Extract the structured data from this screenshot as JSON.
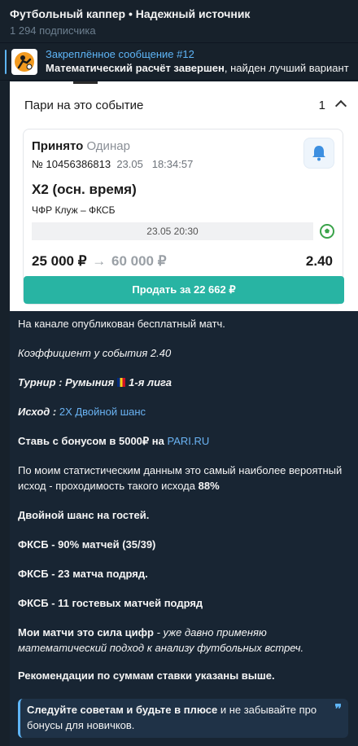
{
  "channel": {
    "title": "Футбольный каппер • Надежный источник",
    "subscribers": "1 294 подписчика"
  },
  "pinned": {
    "label": "Закреплённое сообщение #12",
    "text_bold": "Математический расчёт завершен",
    "text_rest": ", найден лучший вариант"
  },
  "bet_card": {
    "header": "Пари на это событие",
    "count": "1",
    "status": "Принято",
    "type": "Одинар",
    "number": "№ 10456386813",
    "date": "23.05",
    "time": "18:34:57",
    "bet": "Х2 (осн. время)",
    "teams": "ЧФР Клуж – ФКСБ",
    "event_datetime": "23.05 20:30",
    "stake": "25 000 ₽",
    "arrow": "→",
    "payout": "60 000 ₽",
    "coefficient": "2.40",
    "sell_button": "Продать за 22 662 ₽",
    "colors": {
      "accent": "#28b4a3",
      "bell": "#3d8fe0"
    }
  },
  "post": {
    "p1": "На канале опубликован бесплатный матч.",
    "p2": "Коэффициент у события 2.40",
    "p3_label": "Турнир : Румыния",
    "p3_flag": "romania-flag",
    "p3_value": "1-я лига",
    "p4_label": "Исход :",
    "p4_value": "2Х Двойной шанс",
    "p5_text": "Ставь с бонусом в 5000₽ на",
    "p5_link": "PARI.RU",
    "p6_text": "По моим статистическим данным это самый наиболее вероятный исход - проходимость такого исхода",
    "p6_bold": "88%",
    "p7": "Двойной шанс на гостей.",
    "p8": "ФКСБ - 90% матчей (35/39)",
    "p9": "ФКСБ - 23 матча подряд.",
    "p10": "ФКСБ - 11 гостевых матчей подряд",
    "p11_bold": "Мои матчи это сила цифр",
    "p11_rest": " - уже давно применяю математический подход к анализу футбольных встреч.",
    "p12": "Рекомендации по суммам ставки указаны выше.",
    "quote_bold": "Следуйте советам и будьте в плюсе",
    "quote_rest": " и не забывайте про бонусы для новичков.",
    "quote_mark": "❞"
  }
}
